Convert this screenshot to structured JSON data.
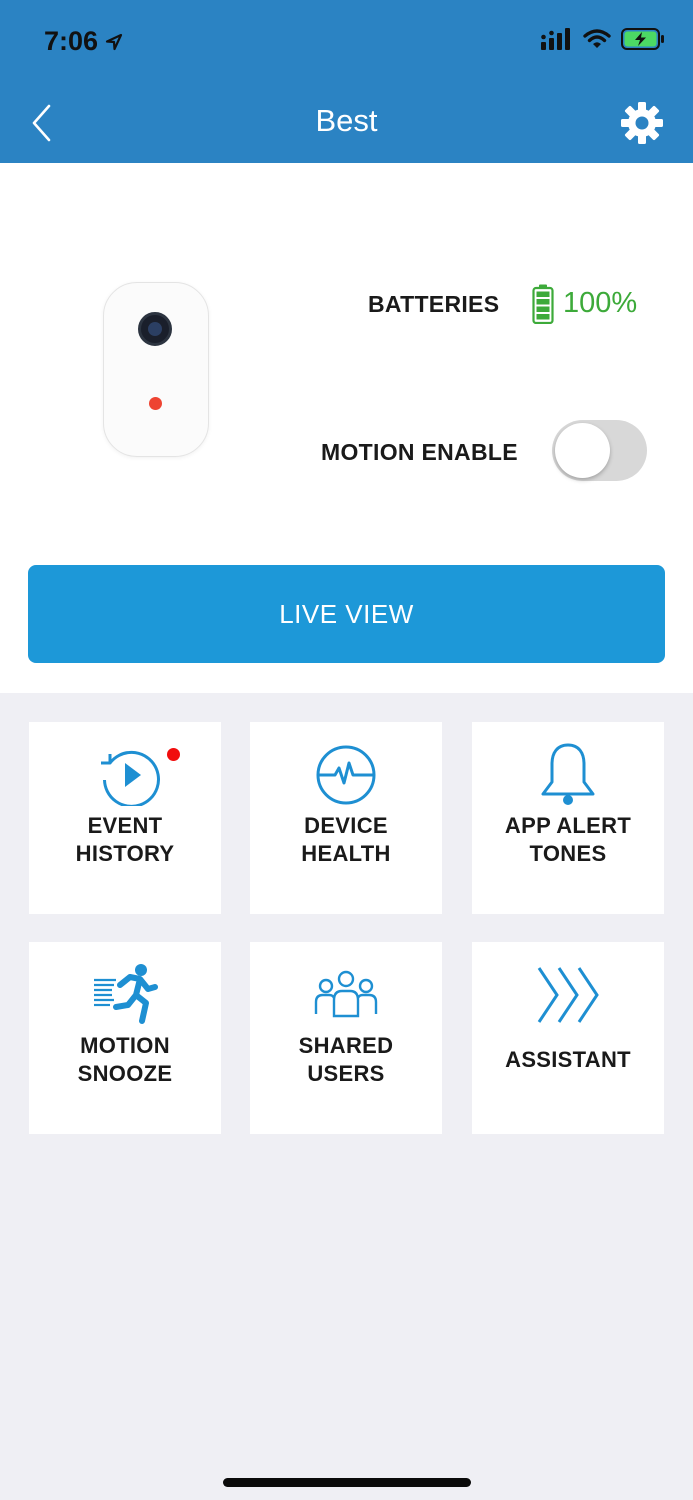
{
  "status_bar": {
    "time": "7:06",
    "icons": [
      "location-arrow-icon",
      "cellular-signal-icon",
      "wifi-icon",
      "battery-charging-icon"
    ]
  },
  "nav": {
    "title": "Best",
    "back_icon": "chevron-left-icon",
    "settings_icon": "gear-icon"
  },
  "device": {
    "batteries_label": "BATTERIES",
    "battery_value": "100%",
    "battery_level": 1.0,
    "battery_color": "#3daa3a",
    "motion_label": "MOTION ENABLE",
    "motion_enabled": false
  },
  "live_view": {
    "label": "LIVE VIEW",
    "color": "#1d98d8"
  },
  "tiles": [
    {
      "line1": "EVENT",
      "line2": "HISTORY",
      "icon": "replay-play-icon",
      "badge": true
    },
    {
      "line1": "DEVICE",
      "line2": "HEALTH",
      "icon": "heartbeat-pulse-icon",
      "badge": false
    },
    {
      "line1": "APP ALERT",
      "line2": "TONES",
      "icon": "bell-icon",
      "badge": false
    },
    {
      "line1": "MOTION",
      "line2": "SNOOZE",
      "icon": "running-person-icon",
      "badge": false
    },
    {
      "line1": "SHARED",
      "line2": "USERS",
      "icon": "users-group-icon",
      "badge": false
    },
    {
      "line1": "ASSISTANT",
      "line2": "",
      "icon": "triple-chevron-right-icon",
      "badge": false
    }
  ],
  "colors": {
    "header": "#2b83c3",
    "accent": "#1d98d8",
    "icon_blue": "#1e8fd2",
    "badge_red": "#f10d0d"
  }
}
